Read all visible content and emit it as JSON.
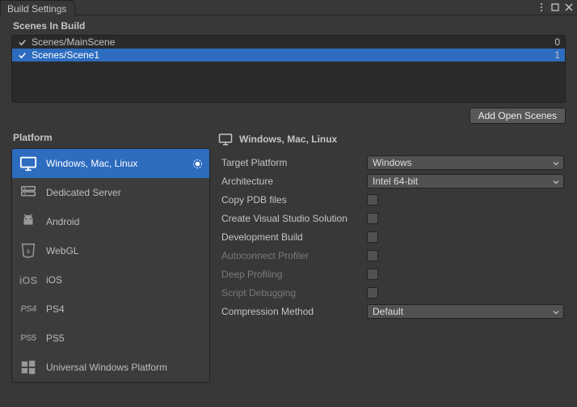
{
  "window": {
    "title": "Build Settings"
  },
  "scenes": {
    "header": "Scenes In Build",
    "items": [
      {
        "checked": true,
        "name": "Scenes/MainScene",
        "index": "0",
        "selected": false
      },
      {
        "checked": true,
        "name": "Scenes/Scene1",
        "index": "1",
        "selected": true
      }
    ],
    "add_open": "Add Open Scenes"
  },
  "platforms": {
    "header": "Platform",
    "items": [
      {
        "label": "Windows, Mac, Linux",
        "selected": true,
        "current": true
      },
      {
        "label": "Dedicated Server",
        "selected": false,
        "current": false
      },
      {
        "label": "Android",
        "selected": false,
        "current": false
      },
      {
        "label": "WebGL",
        "selected": false,
        "current": false
      },
      {
        "label": "iOS",
        "selected": false,
        "current": false
      },
      {
        "label": "PS4",
        "selected": false,
        "current": false
      },
      {
        "label": "PS5",
        "selected": false,
        "current": false
      },
      {
        "label": "Universal Windows Platform",
        "selected": false,
        "current": false
      }
    ]
  },
  "settings": {
    "header": "Windows, Mac, Linux",
    "target_platform": {
      "label": "Target Platform",
      "value": "Windows"
    },
    "architecture": {
      "label": "Architecture",
      "value": "Intel 64-bit"
    },
    "copy_pdb": {
      "label": "Copy PDB files"
    },
    "create_vs": {
      "label": "Create Visual Studio Solution"
    },
    "dev_build": {
      "label": "Development Build"
    },
    "autoconnect": {
      "label": "Autoconnect Profiler"
    },
    "deep_profiling": {
      "label": "Deep Profiling"
    },
    "script_debug": {
      "label": "Script Debugging"
    },
    "compression": {
      "label": "Compression Method",
      "value": "Default"
    }
  }
}
